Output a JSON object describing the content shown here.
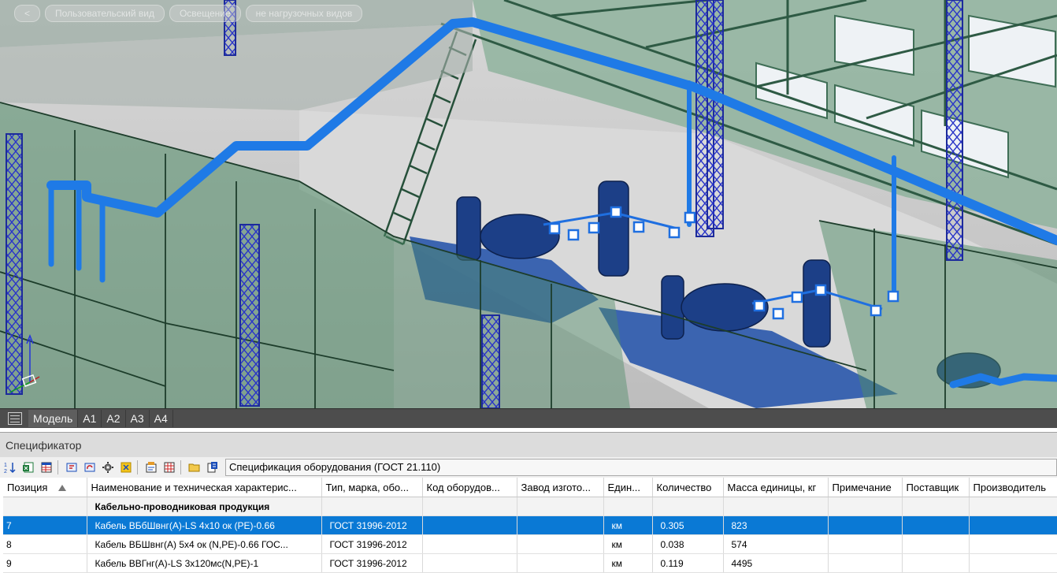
{
  "breadcrumbs": [
    "Пользовательский вид",
    "Освещение",
    "не нагрузочных видов"
  ],
  "layout_tabs": [
    "Модель",
    "A1",
    "A2",
    "A3",
    "A4"
  ],
  "panel_title": "Спецификатор",
  "toolbar_icons": [
    "sort-icon",
    "export-excel-icon",
    "export-table-icon",
    "group-icon",
    "refresh-icon",
    "settings-icon",
    "filter-icon",
    "properties-icon",
    "report-icon",
    "open-folder-icon",
    "template-icon"
  ],
  "spec_name": "Спецификация оборудования (ГОСТ 21.110)",
  "columns": [
    "Позиция",
    "Наименование и техническая характерис...",
    "Тип, марка, обо...",
    "Код оборудов...",
    "Завод изгото...",
    "Един...",
    "Количество",
    "Масса единицы, кг",
    "Примечание",
    "Поставщик",
    "Производитель"
  ],
  "group_label": "Кабельно-проводниковая продукция",
  "rows": [
    {
      "pos": "7",
      "name": "Кабель ВБбШвнг(А)-LS 4x10 ок (PE)-0.66",
      "type": "ГОСТ 31996-2012",
      "code": "",
      "plant": "",
      "unit": "км",
      "qty": "0.305",
      "mass": "823",
      "note": "",
      "supplier": "",
      "maker": ""
    },
    {
      "pos": "8",
      "name": "Кабель ВБШвнг(А) 5x4 ок (N,PE)-0.66  ГОС...",
      "type": "ГОСТ 31996-2012",
      "code": "",
      "plant": "",
      "unit": "км",
      "qty": "0.038",
      "mass": "574",
      "note": "",
      "supplier": "",
      "maker": ""
    },
    {
      "pos": "9",
      "name": "Кабель ВВГнг(А)-LS 3x120мс(N,PE)-1",
      "type": "ГОСТ 31996-2012",
      "code": "",
      "plant": "",
      "unit": "км",
      "qty": "0.119",
      "mass": "4495",
      "note": "",
      "supplier": "",
      "maker": ""
    }
  ],
  "selected_row": 0,
  "colors": {
    "accent": "#0a79d5",
    "cable_tray": "#1f7ae6",
    "walls": "#5f8f72",
    "steel": "#2233a8"
  }
}
